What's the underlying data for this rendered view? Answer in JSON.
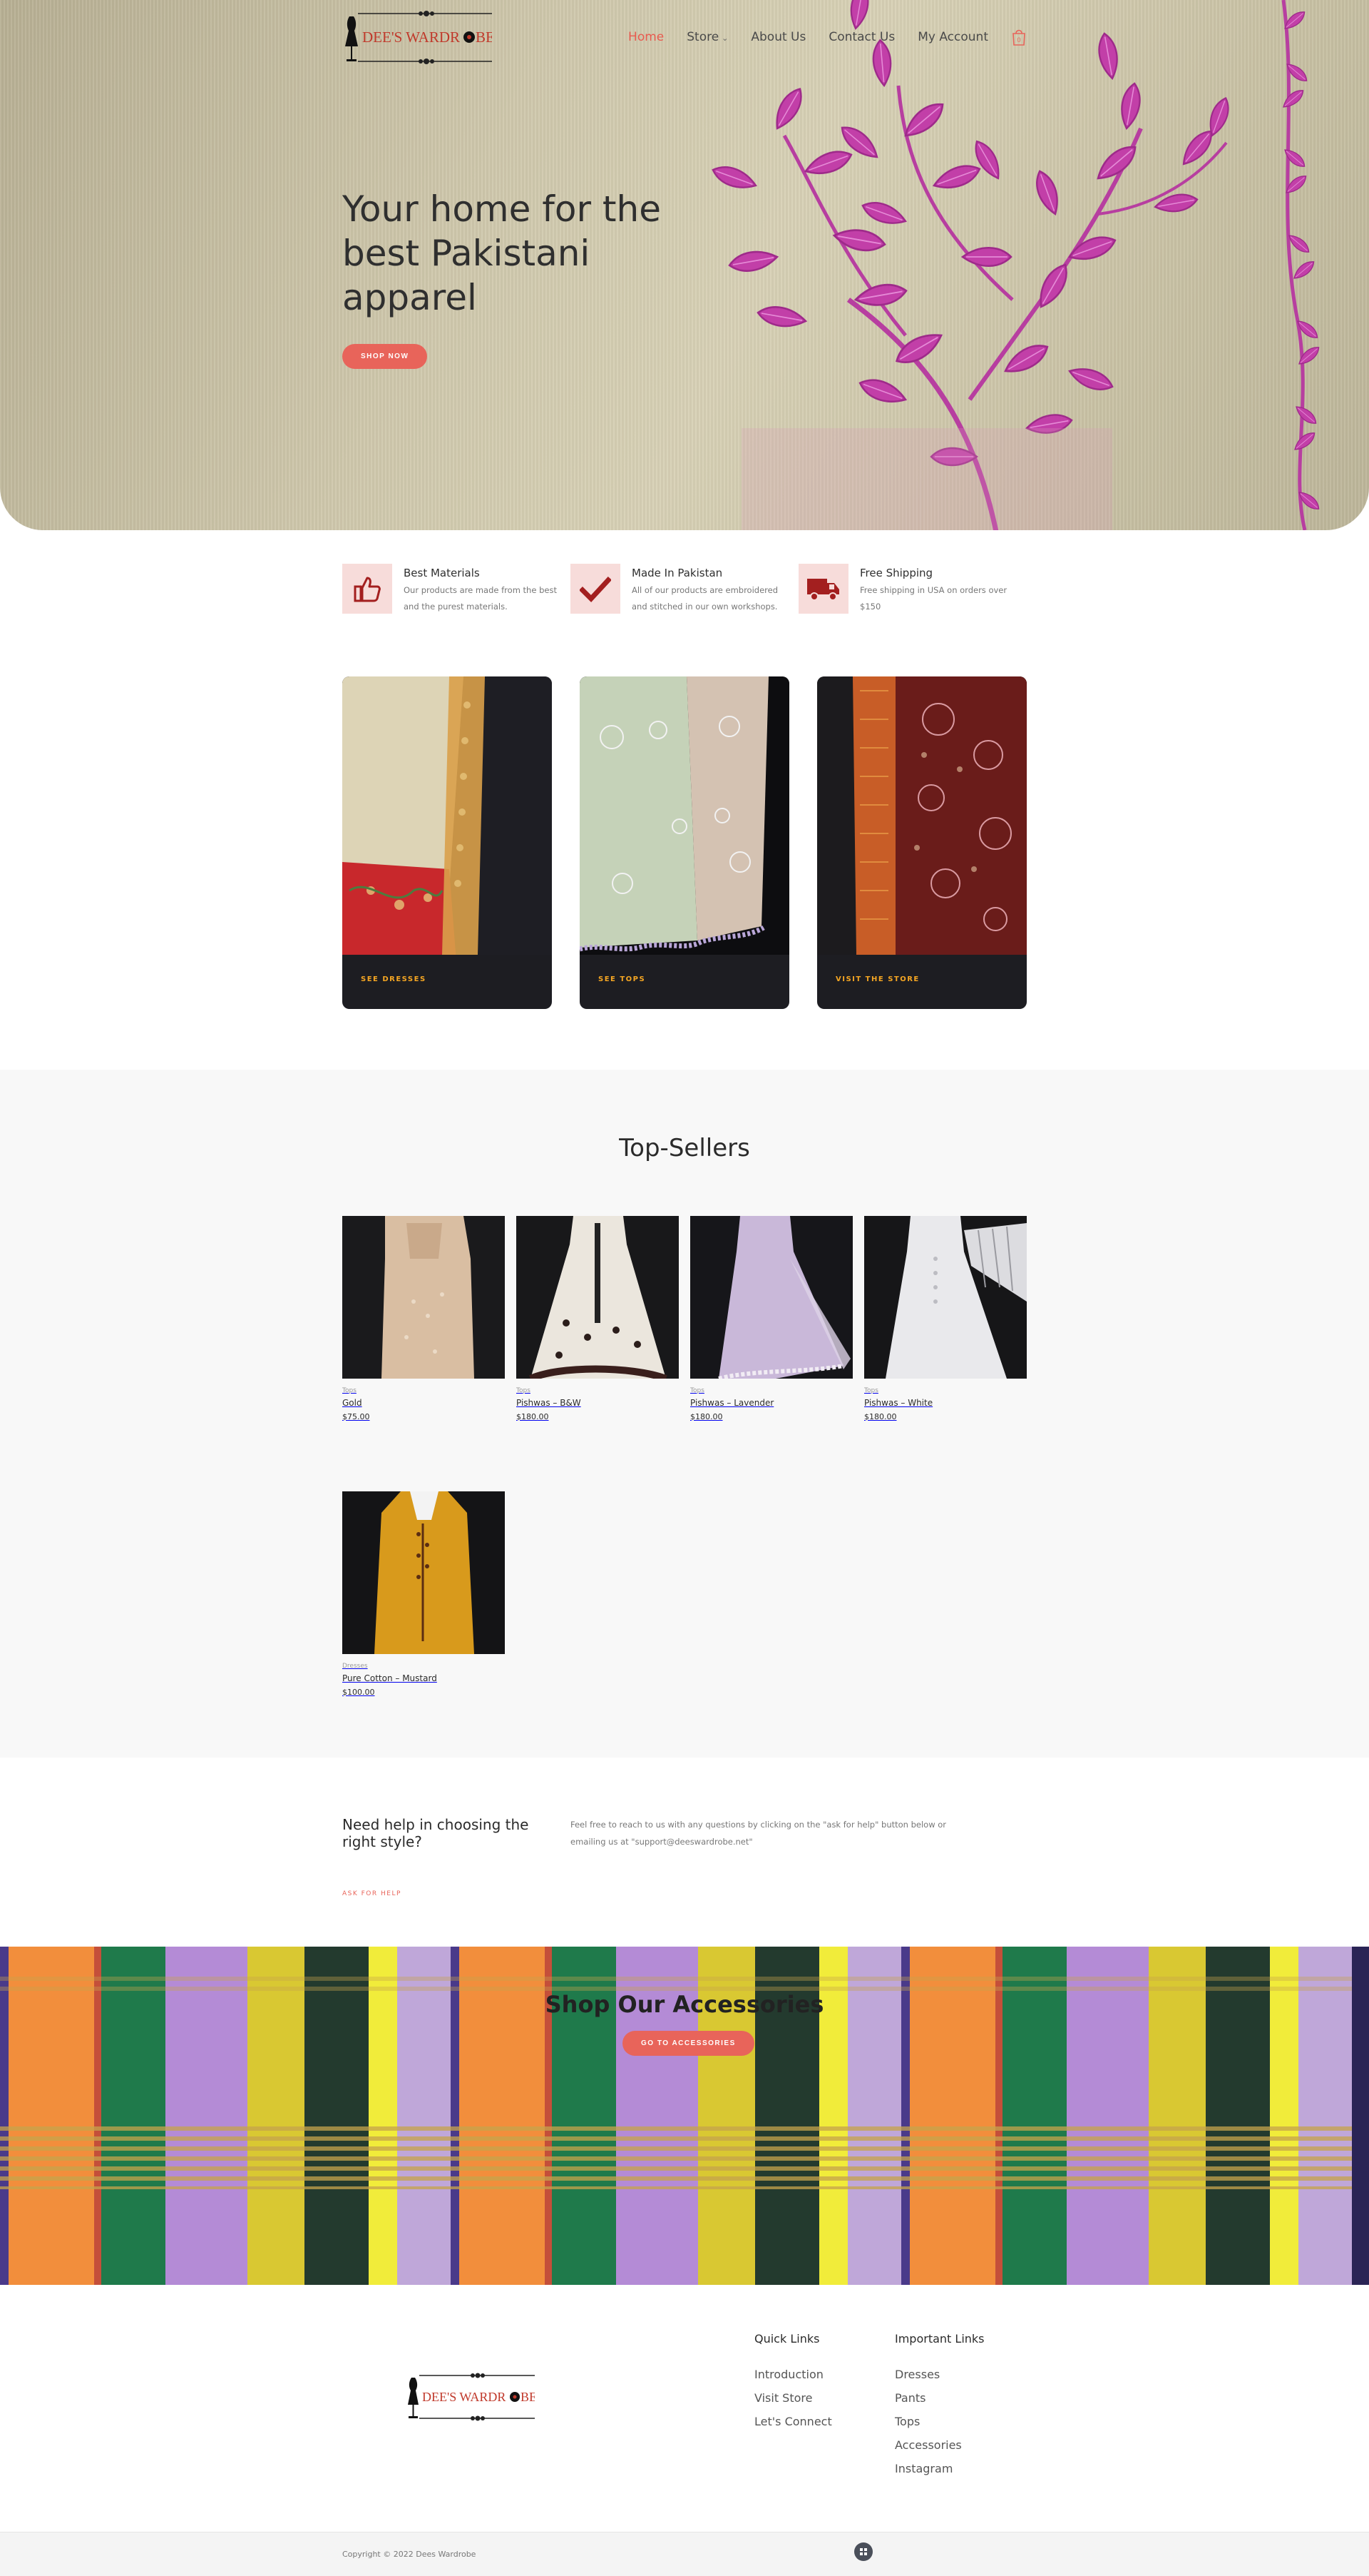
{
  "brand": {
    "logo_text": "DEE'S WARDR",
    "logo_text_end": "BE",
    "accent": "#e8645a",
    "gold": "#f5a623"
  },
  "nav": {
    "items": [
      {
        "label": "Home",
        "active": true
      },
      {
        "label": "Store",
        "dropdown": true
      },
      {
        "label": "About Us"
      },
      {
        "label": "Contact Us"
      },
      {
        "label": "My Account"
      }
    ],
    "cart_count": "0",
    "cart_icon": "shopping-bag-icon"
  },
  "hero": {
    "title": "Your home for the best Pakistani apparel",
    "button": "Shop Now"
  },
  "features": [
    {
      "icon": "thumbs-up-icon",
      "title": "Best Materials",
      "desc": "Our products are made from the best and the purest materials."
    },
    {
      "icon": "checkmark-icon",
      "title": "Made In Pakistan",
      "desc": "All of our products are embroidered and stitched in our own workshops."
    },
    {
      "icon": "delivery-truck-icon",
      "title": "Free Shipping",
      "desc": "Free shipping in USA on orders over $150"
    }
  ],
  "cards": [
    {
      "label": "See Dresses"
    },
    {
      "label": "See Tops"
    },
    {
      "label": "Visit the Store"
    }
  ],
  "top_sellers": {
    "title": "Top-Sellers",
    "products": [
      {
        "category": "Tops",
        "name": "Gold",
        "price": "$75.00"
      },
      {
        "category": "Tops",
        "name": "Pishwas – B&W",
        "price": "$180.00"
      },
      {
        "category": "Tops",
        "name": "Pishwas – Lavender",
        "price": "$180.00"
      },
      {
        "category": "Tops",
        "name": "Pishwas – White",
        "price": "$180.00"
      },
      {
        "category": "Dresses",
        "name": "Pure Cotton – Mustard",
        "price": "$100.00"
      }
    ]
  },
  "help": {
    "title": "Need help in choosing the right style?",
    "text": "Feel free to reach to us with any questions by clicking on the \"ask for help\" button below or emailing us at \"support@deeswardrobe.net\"",
    "link": "Ask for help"
  },
  "accessories": {
    "title": "Shop Our Accessories",
    "button": "Go to Accessories"
  },
  "footer": {
    "quick_links": {
      "title": "Quick Links",
      "items": [
        "Introduction",
        "Visit Store",
        "Let's Connect"
      ]
    },
    "important_links": {
      "title": "Important Links",
      "items": [
        "Dresses",
        "Pants",
        "Tops",
        "Accessories",
        "Instagram"
      ]
    },
    "copyright": "Copyright © 2022 Dees Wardrobe"
  }
}
